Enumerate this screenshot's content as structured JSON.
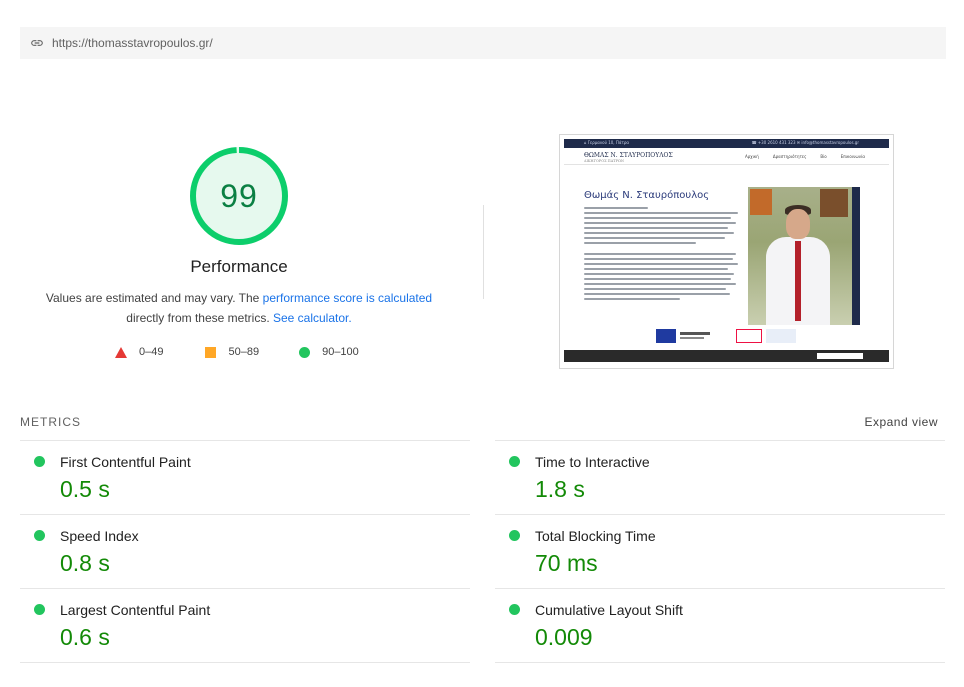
{
  "url": "https://thomasstavropoulos.gr/",
  "performance": {
    "score": "99",
    "score_fraction": 0.99,
    "title": "Performance",
    "desc_prefix": "Values are estimated and may vary. The ",
    "desc_link1": "performance score is calculated",
    "desc_middle": "directly from these metrics. ",
    "desc_link2": "See calculator."
  },
  "legend": [
    {
      "label": "0–49",
      "shape": "triangle",
      "color": "#e53935"
    },
    {
      "label": "50–89",
      "shape": "square",
      "color": "#ffa726"
    },
    {
      "label": "90–100",
      "shape": "circle",
      "color": "#22c55e"
    }
  ],
  "thumbnail": {
    "topbar_left": "⌂ Γερμανού 10, Πάτρα",
    "topbar_right": "☎ +30 2610 431 323   ✉ info@thomasstavropoulos.gr",
    "logo": "ΘΩΜΑΣ Ν. ΣΤΑΥΡΟΠΟΥΛΟΣ",
    "logo_sub": "ΔΙΚΗΓΟΡΟΣ ΠΑΤΡΩΝ",
    "nav": [
      "Αρχική",
      "Δραστηριότητες",
      "Βio",
      "Επικοινωνία"
    ],
    "heading": "Θωμάς Ν. Σταυρόπουλος"
  },
  "metrics": {
    "section_label": "METRICS",
    "expand_label": "Expand view",
    "left": [
      {
        "name": "First Contentful Paint",
        "value": "0.5 s"
      },
      {
        "name": "Speed Index",
        "value": "0.8 s"
      },
      {
        "name": "Largest Contentful Paint",
        "value": "0.6 s"
      }
    ],
    "right": [
      {
        "name": "Time to Interactive",
        "value": "1.8 s"
      },
      {
        "name": "Total Blocking Time",
        "value": "70 ms"
      },
      {
        "name": "Cumulative Layout Shift",
        "value": "0.009"
      }
    ]
  },
  "colors": {
    "pass": "#0cce6b",
    "score_text": "#0b8043",
    "link": "#1a73e8",
    "value": "#138a07"
  }
}
